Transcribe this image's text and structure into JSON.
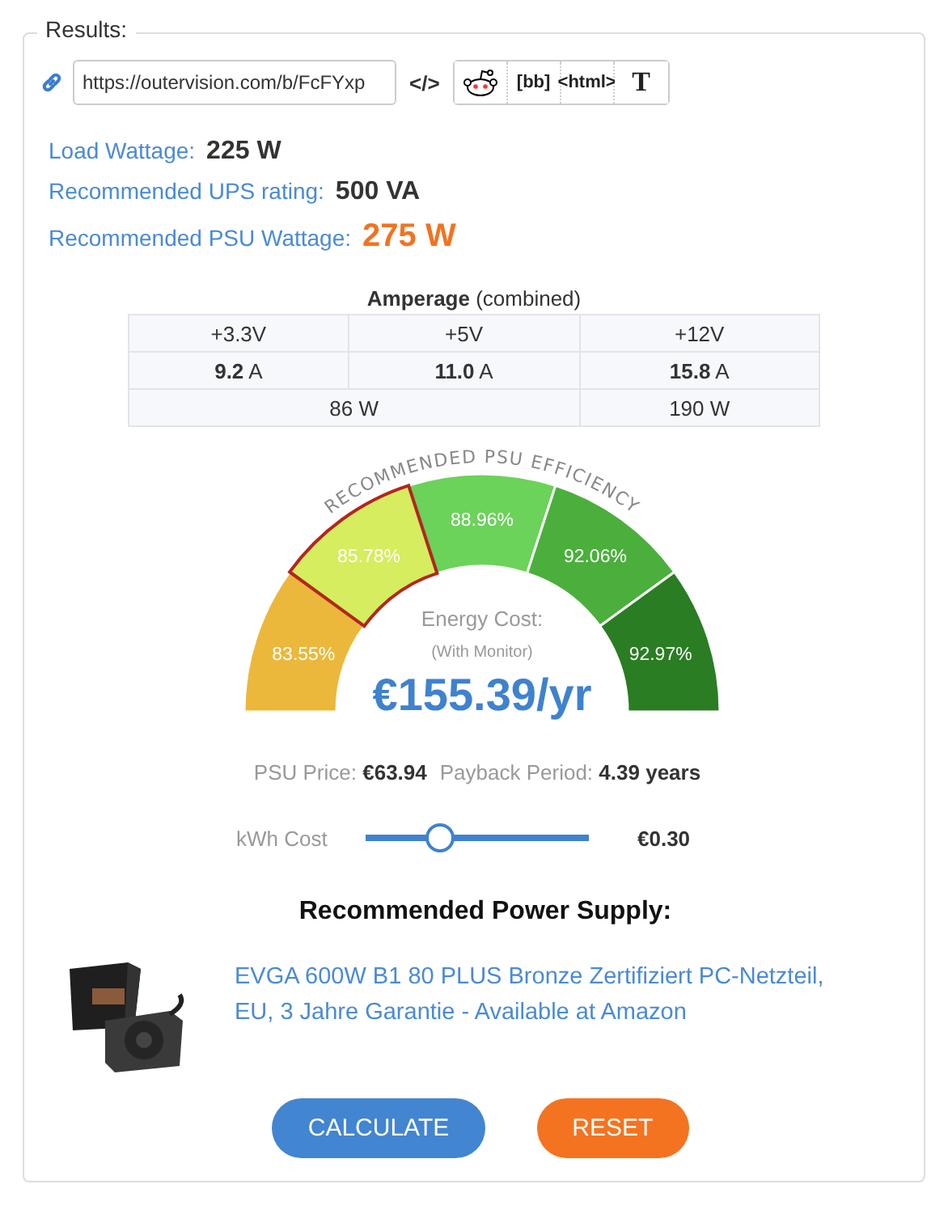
{
  "legend": "Results:",
  "share": {
    "url": "https://outervision.com/b/FcFYxp",
    "embed": "</>",
    "buttons": [
      {
        "kind": "reddit"
      },
      {
        "kind": "text",
        "label": "[bb]"
      },
      {
        "kind": "text",
        "label": "<html>"
      },
      {
        "kind": "serif",
        "label": "T"
      }
    ]
  },
  "results": [
    {
      "label": "Load Wattage:",
      "value": "225 W",
      "highlight": false
    },
    {
      "label": "Recommended UPS rating:",
      "value": "500 VA",
      "highlight": false
    },
    {
      "label": "Recommended PSU Wattage:",
      "value": "275 W",
      "highlight": true
    }
  ],
  "amperage": {
    "title": "Amperage",
    "subtitle": "(combined)",
    "rows": [
      [
        "+3.3V",
        "+5V",
        "+12V"
      ],
      [
        "**9.2** A",
        "**11.0** A",
        "**15.8** A"
      ],
      [
        {
          "text": "86 W",
          "colspan": 2
        },
        "190 W"
      ]
    ]
  },
  "gauge": {
    "title": "RECOMMENDED PSU EFFICIENCY",
    "segments": [
      {
        "label": "83.55%",
        "color": "#ebb83b",
        "selected": false
      },
      {
        "label": "85.78%",
        "color": "#d5ed5f",
        "selected": true
      },
      {
        "label": "88.96%",
        "color": "#6bd25a",
        "selected": false
      },
      {
        "label": "92.06%",
        "color": "#4baf3c",
        "selected": false
      },
      {
        "label": "92.97%",
        "color": "#2a7d22",
        "selected": false
      }
    ],
    "cost_label": "Energy Cost:",
    "cost_note": "(With Monitor)",
    "cost": "€155.39/yr"
  },
  "payback": [
    {
      "label": "PSU Price:",
      "value": "€63.94"
    },
    {
      "label": "Payback Period:",
      "value": "4.39 years"
    }
  ],
  "kwh": {
    "label": "kWh Cost",
    "level": 0.33,
    "value": "€0.30"
  },
  "recommendation": {
    "heading": "Recommended Power Supply:",
    "product": "EVGA 600W B1 80 PLUS Bronze Zertifiziert PC-Netzteil, EU, 3 Jahre Garantie - Available at Amazon"
  },
  "buttons": [
    {
      "label": "CALCULATE",
      "kind": "primary"
    },
    {
      "label": "RESET",
      "kind": "reset"
    }
  ]
}
